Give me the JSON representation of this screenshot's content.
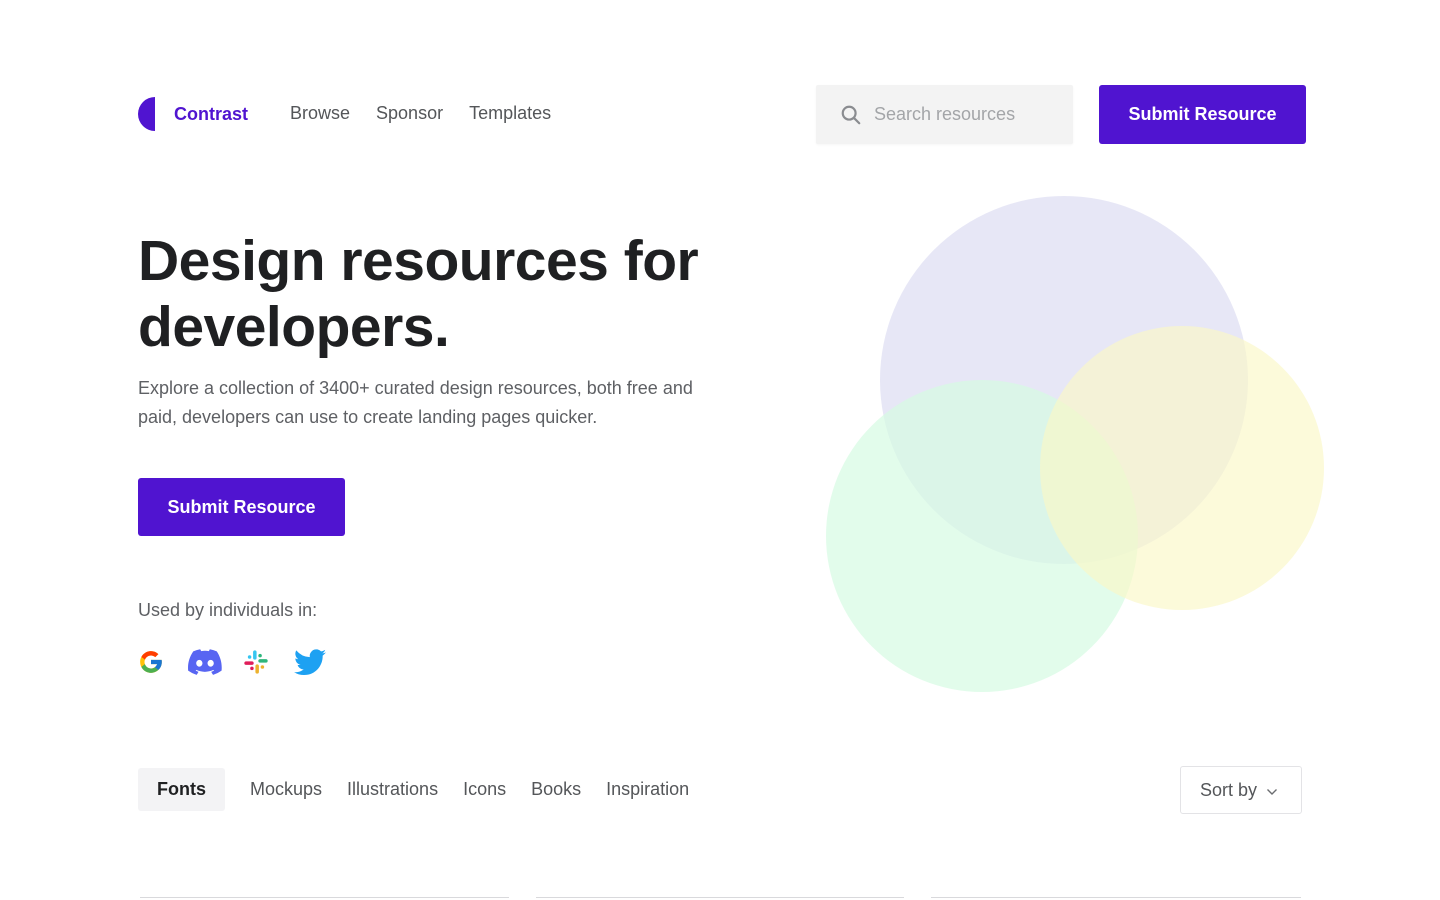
{
  "brand": {
    "name": "Contrast",
    "color": "#5014d0"
  },
  "nav": {
    "items": [
      "Browse",
      "Sponsor",
      "Templates"
    ]
  },
  "search": {
    "placeholder": "Search resources",
    "icon": "search-icon"
  },
  "header": {
    "submit_label": "Submit Resource"
  },
  "hero": {
    "title": "Design resources for developers.",
    "subtitle": "Explore a collection of 3400+ curated design resources, both free and paid, developers can use to create landing pages quicker.",
    "cta_label": "Submit Resource",
    "used_by_label": "Used by individuals in:",
    "logos": [
      "google-logo",
      "discord-logo",
      "slack-logo",
      "twitter-logo"
    ]
  },
  "decorative": {
    "circle_colors": [
      "#e9e9f7",
      "#dcfde7",
      "#fdfbd6"
    ]
  },
  "filters": {
    "tabs": [
      "Fonts",
      "Mockups",
      "Illustrations",
      "Icons",
      "Books",
      "Inspiration"
    ],
    "active_tab": "Fonts",
    "sort_label": "Sort by"
  },
  "colors": {
    "accent": "#5014d0",
    "text_dark": "#1f2022",
    "text_muted": "#5e6064"
  }
}
